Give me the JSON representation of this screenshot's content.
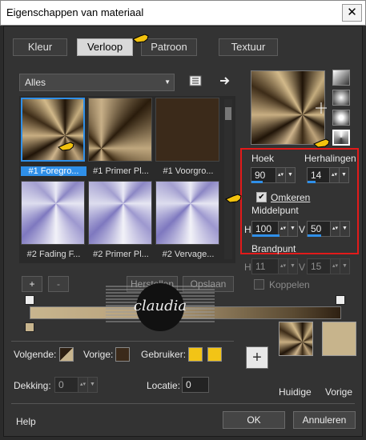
{
  "window": {
    "title": "Eigenschappen van materiaal",
    "close_glyph": "✕"
  },
  "tabs": [
    {
      "label": "Kleur",
      "active": false
    },
    {
      "label": "Verloop",
      "active": true
    },
    {
      "label": "Patroon",
      "active": false
    },
    {
      "label": "Textuur",
      "active": false
    }
  ],
  "gallery": {
    "category": "Alles",
    "items": [
      {
        "label": "#1 Foregro...",
        "selected": true
      },
      {
        "label": "#1 Primer Pl...",
        "selected": false
      },
      {
        "label": "#1 Voorgro...",
        "selected": false
      },
      {
        "label": "#2 Fading F...",
        "selected": false
      },
      {
        "label": "#2 Primer Pl...",
        "selected": false
      },
      {
        "label": "#2 Vervage...",
        "selected": false
      }
    ],
    "add_label": "+",
    "remove_label": "-",
    "restore_label": "Herstellen",
    "save_label": "Opslaan"
  },
  "settings": {
    "hoek_label": "Hoek",
    "hoek_value": "90",
    "herhalingen_label": "Herhalingen",
    "herhalingen_value": "14",
    "omkeren_label": "Omkeren",
    "omkeren_checked": true,
    "middelpunt_label": "Middelpunt",
    "h_label": "H",
    "h_value": "100",
    "v_label": "V",
    "v_value": "50",
    "brandpunt_label": "Brandpunt",
    "bh_value": "11",
    "bv_value": "15",
    "koppelen_label": "Koppelen",
    "koppelen_checked": false
  },
  "colors_row": {
    "volgende_label": "Volgende:",
    "vorige_label": "Vorige:",
    "gebruiker_label": "Gebruiker:",
    "dekking_label": "Dekking:",
    "dekking_value": "0",
    "locatie_label": "Locatie:",
    "locatie_value": "0",
    "add_label": "+",
    "huidige_label": "Huidige",
    "vorige2_label": "Vorige",
    "user_color": "#f2c416",
    "prev_color": "#c7b48c"
  },
  "watermark": {
    "text": "claudia"
  },
  "footer": {
    "help_label": "Help",
    "ok_label": "OK",
    "cancel_label": "Annuleren"
  },
  "accent": "#2f8fe8",
  "highlight": "#e21a1a"
}
